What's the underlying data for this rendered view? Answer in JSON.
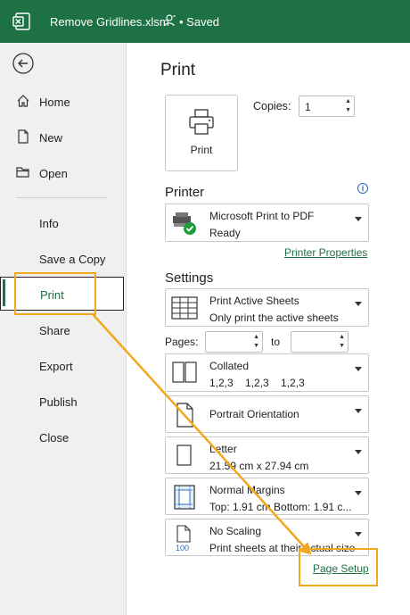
{
  "titlebar": {
    "filename": "Remove Gridlines.xlsm",
    "status": "• Saved",
    "accent": "#1e7145"
  },
  "sidebar": {
    "items": [
      {
        "label": "Home",
        "icon": "home-icon"
      },
      {
        "label": "New",
        "icon": "new-doc-icon"
      },
      {
        "label": "Open",
        "icon": "folder-icon"
      },
      {
        "label": "Info"
      },
      {
        "label": "Save a Copy"
      },
      {
        "label": "Print",
        "active": true
      },
      {
        "label": "Share"
      },
      {
        "label": "Export"
      },
      {
        "label": "Publish"
      },
      {
        "label": "Close"
      }
    ]
  },
  "print": {
    "title": "Print",
    "button_label": "Print",
    "copies_label": "Copies:",
    "copies_value": "1"
  },
  "printer": {
    "heading": "Printer",
    "name": "Microsoft Print to PDF",
    "status": "Ready",
    "properties_link": "Printer Properties"
  },
  "settings": {
    "heading": "Settings",
    "sheets": {
      "line1": "Print Active Sheets",
      "line2": "Only print the active sheets"
    },
    "pages_label": "Pages:",
    "pages_from": "",
    "to_label": "to",
    "pages_to": "",
    "collation": {
      "line1": "Collated",
      "line2": "1,2,3    1,2,3    1,2,3"
    },
    "orientation": {
      "line1": "Portrait Orientation"
    },
    "paper": {
      "line1": "Letter",
      "line2": "21.59 cm x 27.94 cm"
    },
    "margins": {
      "line1": "Normal Margins",
      "line2": "Top: 1.91 cm Bottom: 1.91 c..."
    },
    "scaling": {
      "line1": "No Scaling",
      "line2": "Print sheets at their actual size",
      "icon_text": "100"
    },
    "page_setup_link": "Page Setup"
  },
  "annotation": {
    "color": "#f2a81d"
  }
}
